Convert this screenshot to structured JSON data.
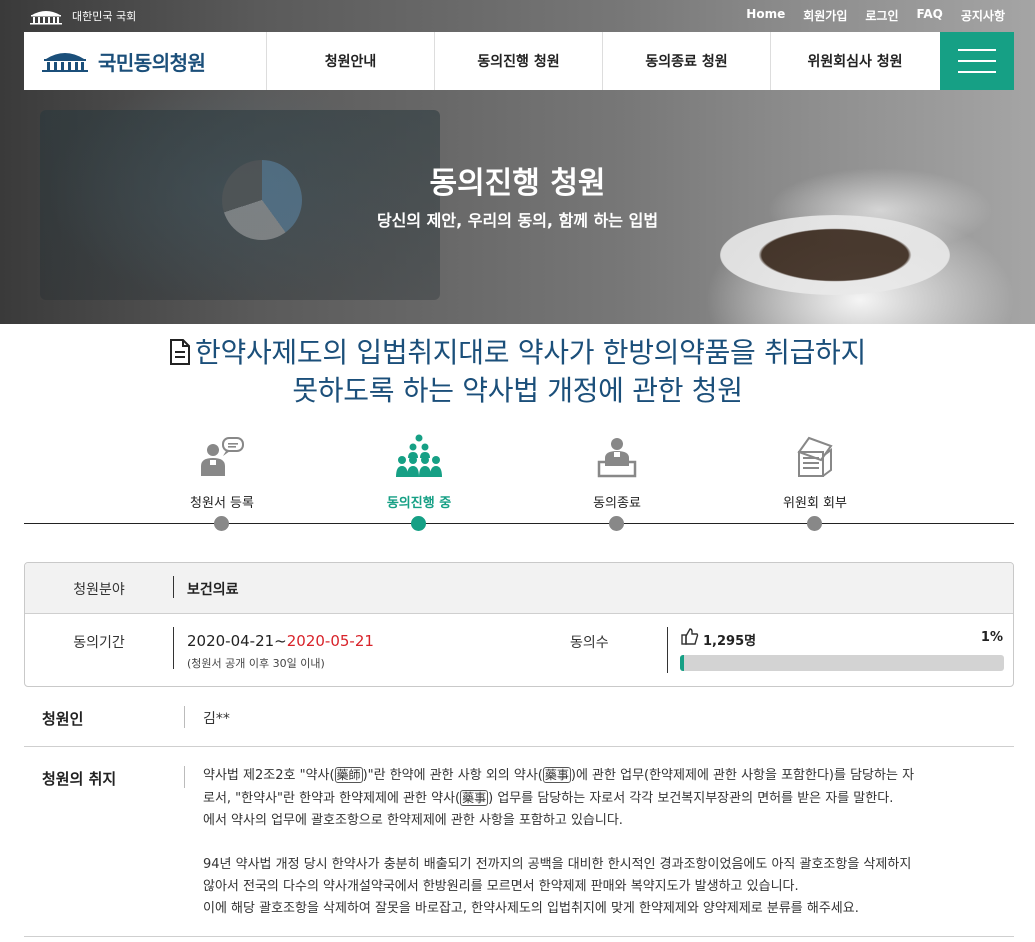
{
  "header": {
    "brand": "대한민국 국회",
    "top_links": [
      "Home",
      "회원가입",
      "로그인",
      "FAQ",
      "공지사항"
    ],
    "logo_text": "국민동의청원",
    "nav": [
      "청원안내",
      "동의진행 청원",
      "동의종료 청원",
      "위원회심사 청원"
    ]
  },
  "hero": {
    "title": "동의진행 청원",
    "subtitle": "당신의 제안, 우리의 동의, 함께 하는 입법"
  },
  "petition": {
    "title_line1": "한약사제도의 입법취지대로 약사가 한방의약품을 취급하지",
    "title_line2": "못하도록 하는 약사법 개정에 관한 청원"
  },
  "steps": [
    {
      "label": "청원서 등록",
      "active": false
    },
    {
      "label": "동의진행 중",
      "active": true
    },
    {
      "label": "동의종료",
      "active": false
    },
    {
      "label": "위원회 회부",
      "active": false
    }
  ],
  "info": {
    "field_label": "청원분야",
    "field_value": "보건의료",
    "period_label": "동의기간",
    "period_start": "2020-04-21~",
    "period_end": "2020-05-21",
    "period_note": "(청원서 공개 이후 30일 이내)",
    "count_label": "동의수",
    "count_value": "1,295명",
    "percent": "1%",
    "progress_fraction": 0.01
  },
  "details": {
    "petitioner_label": "청원인",
    "petitioner_value": "김**",
    "purpose_label": "청원의 취지",
    "para1": [
      [
        "약사법 제2조2호 \"약사(",
        "藥師",
        ")\"란 한약에 관한 사항 외의 약사(",
        "藥事",
        ")에 관한 업무(한약제제에 관한 사항을 포함한다)를 담당하는 자"
      ],
      [
        "로서, \"한약사\"란 한약과 한약제제에 관한 약사(",
        "藥事",
        ") 업무를 담당하는 자로서 각각 보건복지부장관의 면허를 받은 자를 말한다."
      ],
      [
        "에서 약사의 업무에 괄호조항으로 한약제제에 관한 사항을 포함하고 있습니다."
      ]
    ],
    "para2": [
      "94년 약사법 개정 당시 한약사가 충분히 배출되기 전까지의 공백을 대비한 한시적인 경과조항이었음에도 아직 괄호조항을 삭제하지",
      "않아서 전국의 다수의 약사개설약국에서 한방원리를 모르면서 한약제제 판매와 복약지도가 발생하고 있습니다.",
      "이에 해당 괄호조항을 삭제하여 잘못을 바로잡고, 한약사제도의 입법취지에 맞게 한약제제와 양약제제로 분류를 해주세요."
    ]
  }
}
